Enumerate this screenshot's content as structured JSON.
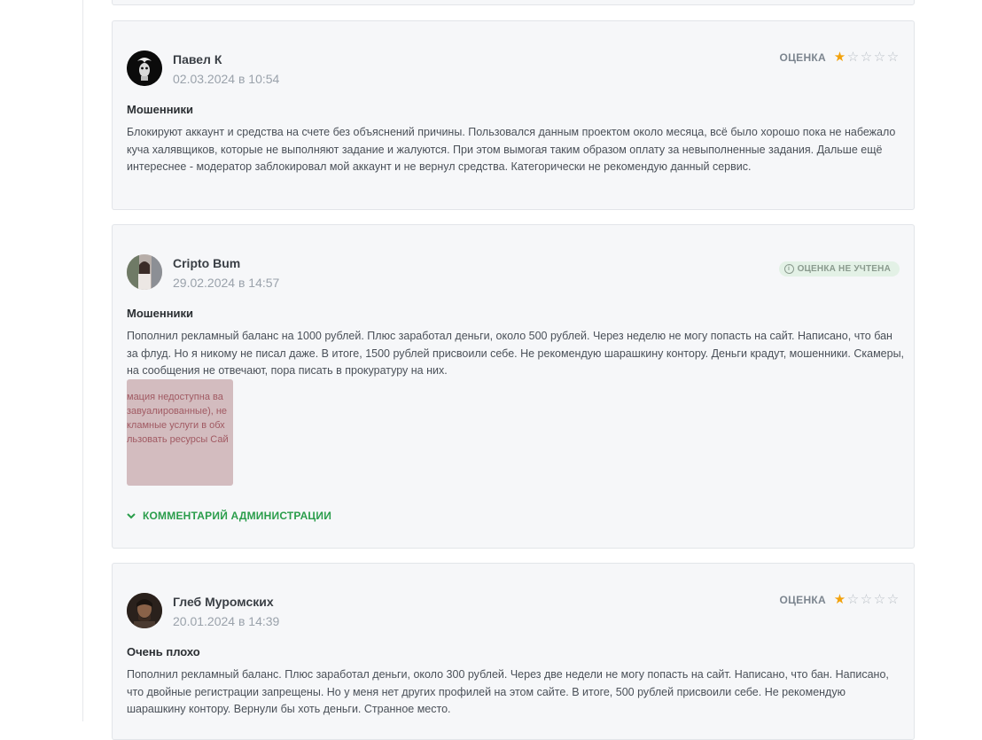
{
  "reviews": [
    {
      "author": "Павел К",
      "date": "02.03.2024 в 10:54",
      "rating_label": "ОЦЕНКА",
      "rating": 1,
      "rating_max": 5,
      "title": "Мошенники",
      "text": "Блокируют аккаунт и средства на счете без объяснений причины. Пользовался данным проектом около месяца, всё было хорошо пока не набежало куча халявщиков, которые не выполняют задание и жалуются. При этом вымогая таким образом оплату за невыполненные задания. Дальше ещё интереснее - модератор заблокировал мой аккаунт и не вернул средства. Категорически не рекомендую данный сервис."
    },
    {
      "author": "Cripto Bum",
      "date": "29.02.2024 в 14:57",
      "badge": "ОЦЕНКА НЕ УЧТЕНА",
      "title": "Мошенники",
      "text": "Пополнил рекламный баланс на 1000 рублей. Плюс заработал деньги, около 500 рублей. Через неделю не могу попасть на сайт. Написано, что бан за флуд. Но я никому не писал даже. В итоге, 1500 рублей присвоили себе. Не рекомендую шарашкину контору. Деньги крадут, мошенники. Скамеры, на сообщения не отвечают, пора писать в прокуратуру на них.",
      "attachment_lines": [
        "мация недоступна ва",
        "завуалированные), не",
        "кламные услуги в обх",
        "льзовать ресурсы Сай"
      ],
      "admin_comment_label": "КОММЕНТАРИЙ АДМИНИСТРАЦИИ"
    },
    {
      "author": "Глеб Муромских",
      "date": "20.01.2024 в 14:39",
      "rating_label": "ОЦЕНКА",
      "rating": 1,
      "rating_max": 5,
      "title": "Очень плохо",
      "text": "Пополнил рекламный баланс. Плюс заработал деньги, около 300 рублей. Через две недели не могу попасть на сайт. Написано, что бан. Написано, что двойные регистрации запрещены. Но у меня нет других профилей на этом сайте. В итоге, 500 рублей присвоили себе. Не рекомендую шарашкину контору. Вернули бы хоть деньги. Странное место."
    }
  ],
  "icons": {
    "star_filled": "★",
    "star_empty": "☆",
    "info": "i",
    "chevron": "⌄"
  },
  "colors": {
    "accent_green": "#2a9d4b",
    "star": "#f2a20d",
    "card_bg": "#f6f7f9"
  }
}
